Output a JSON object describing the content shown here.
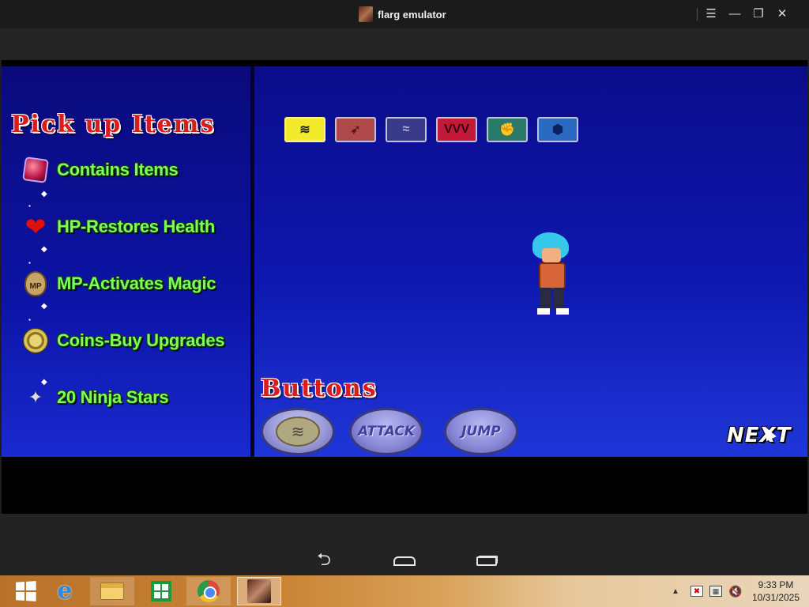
{
  "window": {
    "title": "flarg emulator",
    "controls": {
      "menu": "☰",
      "minimize": "—",
      "restore": "❐",
      "close": "✕"
    }
  },
  "game": {
    "pickup_heading": "Pick up Items",
    "items": [
      {
        "label": "Contains Items",
        "icon": "item-box-icon"
      },
      {
        "label": "HP-Restores Health",
        "icon": "heart-icon"
      },
      {
        "label": "MP-Activates Magic",
        "icon": "mp-bag-icon",
        "icon_text": "MP"
      },
      {
        "label": "Coins-Buy Upgrades",
        "icon": "coin-icon"
      },
      {
        "label": "20 Ninja Stars",
        "icon": "ninja-star-icon"
      }
    ],
    "skill_icons": [
      {
        "name": "tornado-skill-icon",
        "glyph": "≋"
      },
      {
        "name": "kunai-skill-icon",
        "glyph": "➶"
      },
      {
        "name": "wind-skill-icon",
        "glyph": "≈"
      },
      {
        "name": "claw-skill-icon",
        "glyph": "VVV"
      },
      {
        "name": "fist-skill-icon",
        "glyph": "✊"
      },
      {
        "name": "shield-skill-icon",
        "glyph": "⬢"
      }
    ],
    "buttons_heading": "Buttons",
    "buttons": {
      "special_glyph": "≋",
      "attack": "ATTACK",
      "jump": "JUMP"
    },
    "next_label": "NEXT"
  },
  "navbar": {
    "back": "⮌"
  },
  "taskbar": {
    "clock_time": "9:33 PM",
    "clock_date": "10/31/2025",
    "ie_glyph": "e",
    "tray_up": "▲",
    "tray_flag": "✖",
    "tray_net": "▦",
    "tray_vol": "🔇"
  }
}
